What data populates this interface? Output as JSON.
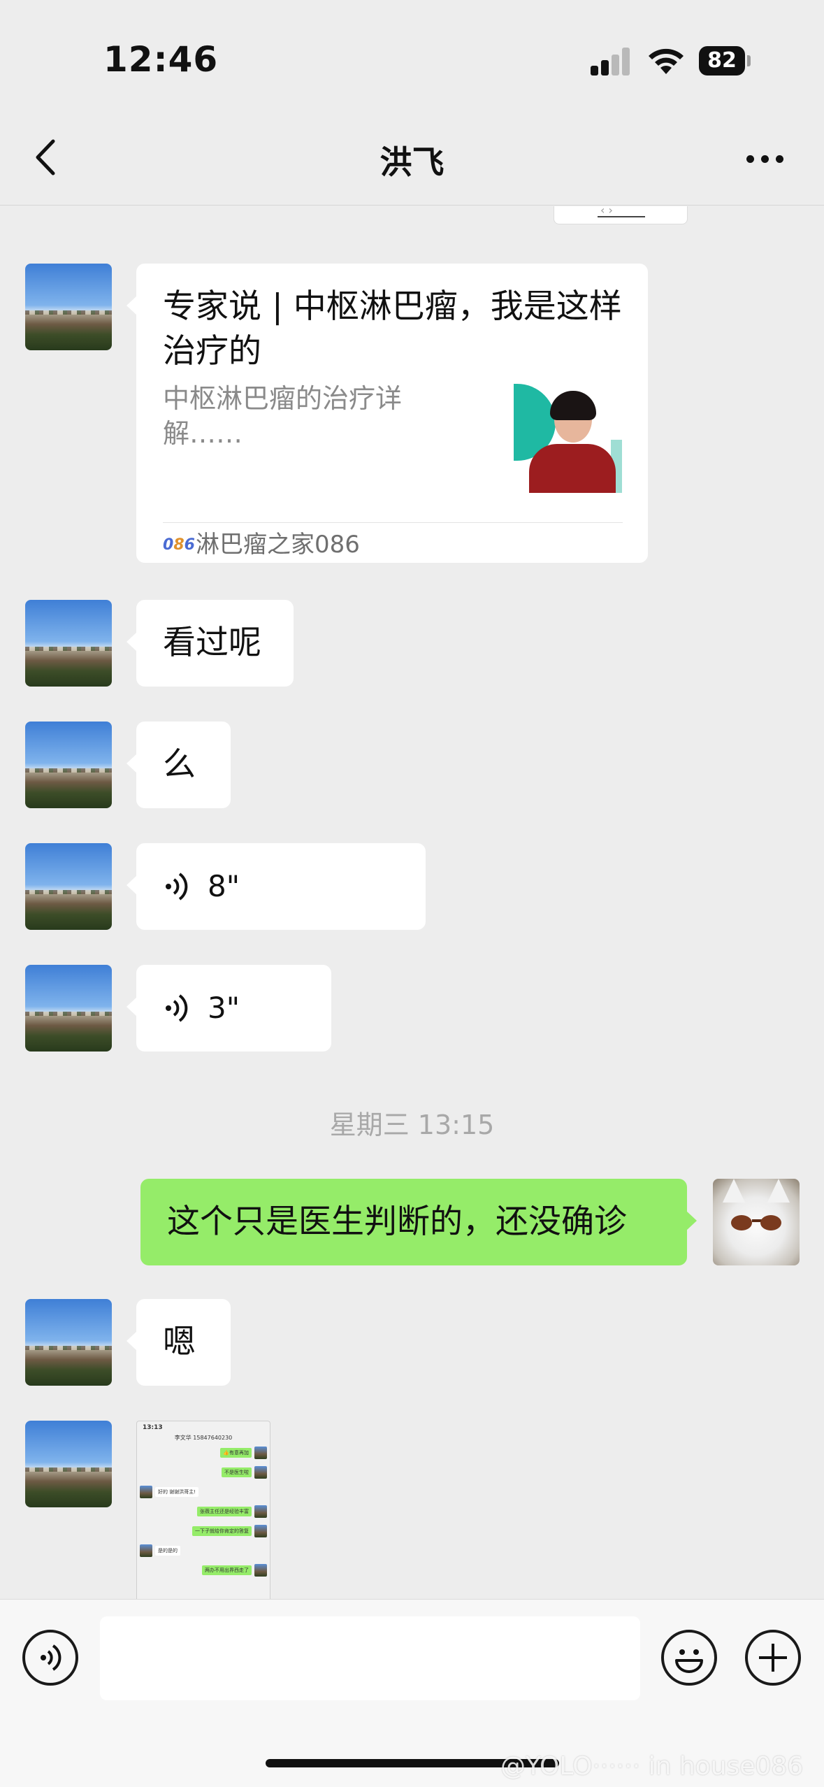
{
  "status_bar": {
    "time": "12:46",
    "battery": "82"
  },
  "nav": {
    "title": "洪飞"
  },
  "messages": {
    "article": {
      "title": "专家说 | 中枢淋巴瘤，我是这样治疗的",
      "description": "中枢淋巴瘤的治疗详解……",
      "source": "淋巴瘤之家086"
    },
    "text1": "看过呢",
    "text2": "么",
    "voice1": "8\"",
    "voice2": "3\"",
    "timestamp": "星期三 13:15",
    "sent1": "这个只是医生判断的，还没确诊",
    "text3": "嗯",
    "image_preview": {
      "status_time": "13:13",
      "header": "李文华 15847640230",
      "rows": [
        "👍有意再加",
        "不是医生啦",
        "好的 谢谢洪哥主!",
        "张薇主任还是经验丰富",
        "一下子就给你肯定的答复",
        "是的是的",
        "两办不用出界西走了"
      ]
    }
  },
  "watermark": "@YOLO······ in house086",
  "colors": {
    "sent_bubble": "#95ec69",
    "received_bubble": "#ffffff",
    "background": "#ededed"
  },
  "icons": [
    "back-chevron-icon",
    "more-dots-icon",
    "signal-icon",
    "wifi-icon",
    "battery-icon",
    "voice-wave-icon",
    "emoji-icon",
    "plus-icon"
  ]
}
